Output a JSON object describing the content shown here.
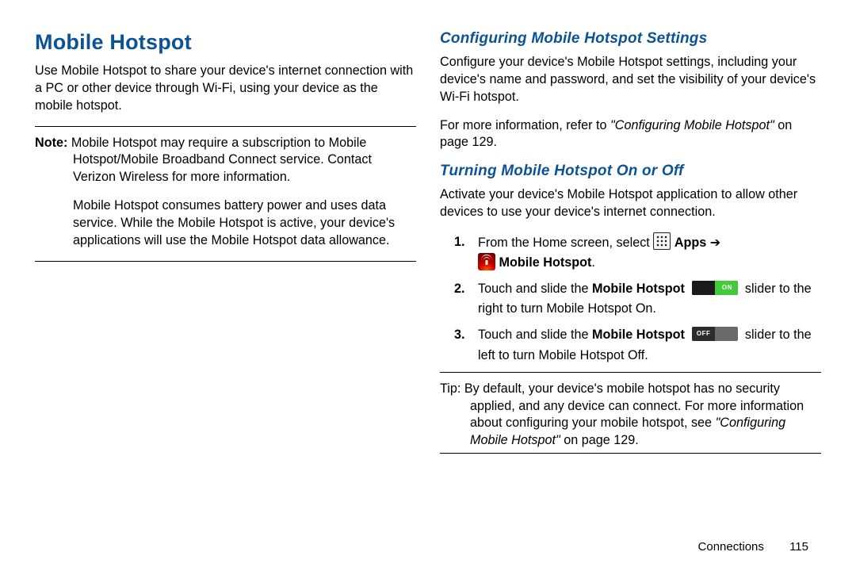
{
  "left": {
    "title": "Mobile Hotspot",
    "intro": "Use Mobile Hotspot to share your device's internet connection with a PC or other device through Wi‑Fi, using your device as the mobile hotspot.",
    "note_label": "Note:",
    "note_p1_rest": " Mobile Hotspot may require a subscription to Mobile Hotspot/Mobile Broadband Connect service. Contact Verizon Wireless for more information.",
    "note_p2": "Mobile Hotspot consumes battery power and uses data service. While the Mobile Hotspot is active, your device's applications will use the Mobile Hotspot data allowance."
  },
  "right": {
    "config_title": "Configuring Mobile Hotspot Settings",
    "config_p1": "Configure your device's Mobile Hotspot settings, including your device's name and password, and set the visibility of your device's Wi‑Fi hotspot.",
    "config_p2_a": "For more information, refer to ",
    "config_p2_ref": "\"Configuring Mobile Hotspot\"",
    "config_p2_b": " on page 129.",
    "turn_title": "Turning Mobile Hotspot On or Off",
    "turn_intro": "Activate your device's Mobile Hotspot application to allow other devices to use your device's internet connection.",
    "step1_a": "From the Home screen, select ",
    "step1_apps": " Apps ",
    "step1_arrow": "➔",
    "step1_hotspot": " Mobile Hotspot",
    "step1_end": ".",
    "step2_a": "Touch and slide the ",
    "step2_b": "Mobile Hotspot",
    "step2_on": "ON",
    "step2_c": " slider to the right to turn Mobile Hotspot On.",
    "step3_a": "Touch and slide the ",
    "step3_b": "Mobile Hotspot",
    "step3_off": "OFF",
    "step3_c": " slider to the left to turn Mobile Hotspot Off.",
    "tip_label": "Tip:",
    "tip_rest": " By default, your device's mobile hotspot has no security applied, and any device can connect. For more information about configuring your mobile hotspot, see ",
    "tip_ref": "\"Configuring Mobile Hotspot\"",
    "tip_end": " on page 129."
  },
  "footer": {
    "chapter": "Connections",
    "page": "115"
  }
}
